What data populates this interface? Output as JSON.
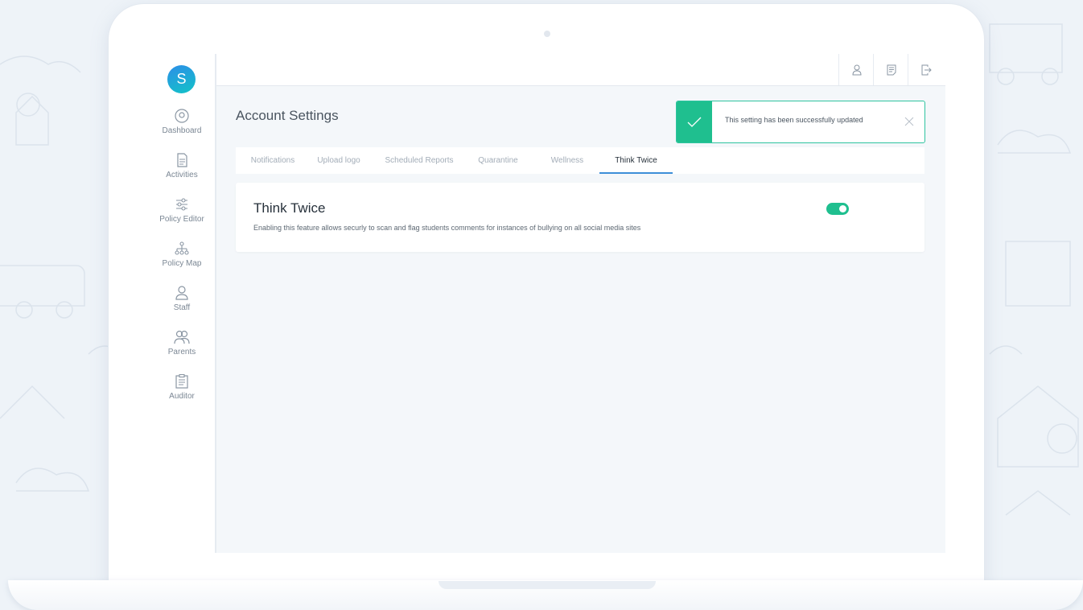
{
  "app": {
    "logo_letter": "S"
  },
  "sidebar": {
    "items": [
      {
        "label": "Dashboard",
        "icon": "dashboard-icon"
      },
      {
        "label": "Activities",
        "icon": "activities-icon"
      },
      {
        "label": "Policy Editor",
        "icon": "sliders-icon"
      },
      {
        "label": "Policy Map",
        "icon": "sitemap-icon"
      },
      {
        "label": "Staff",
        "icon": "user-icon"
      },
      {
        "label": "Parents",
        "icon": "users-icon"
      },
      {
        "label": "Auditor",
        "icon": "clipboard-icon"
      }
    ]
  },
  "topbar": {
    "buttons": [
      {
        "icon": "user-account-icon"
      },
      {
        "icon": "notes-icon"
      },
      {
        "icon": "logout-icon"
      }
    ]
  },
  "page": {
    "title": "Account Settings"
  },
  "toast": {
    "message": "This setting has been successfully updated",
    "status_color": "#1fbf8f"
  },
  "tabs": [
    {
      "label": "Notifications",
      "active": false
    },
    {
      "label": "Upload logo",
      "active": false
    },
    {
      "label": "Scheduled Reports",
      "active": false
    },
    {
      "label": "Quarantine",
      "active": false
    },
    {
      "label": "Wellness",
      "active": false
    },
    {
      "label": "Think Twice",
      "active": true
    }
  ],
  "setting": {
    "title": "Think Twice",
    "description": "Enabling this feature allows securly to scan and flag students comments for instances of bullying on all social media sites",
    "enabled": true
  },
  "colors": {
    "accent": "#1fbf8f",
    "active_tab_underline": "#3d8ed8"
  }
}
